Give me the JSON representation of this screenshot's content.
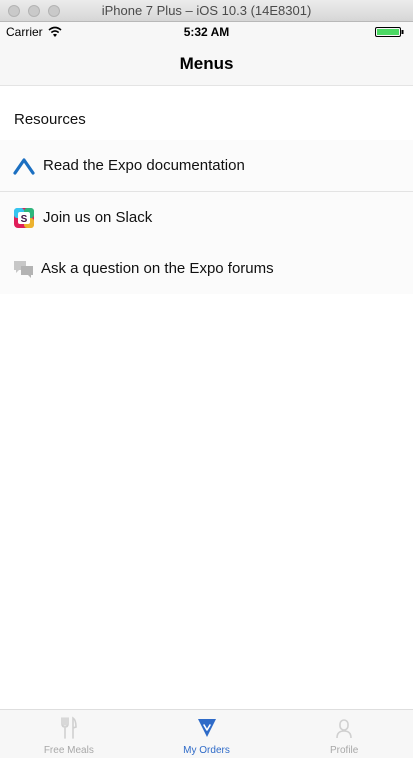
{
  "window": {
    "title": "iPhone 7 Plus – iOS 10.3 (14E8301)"
  },
  "status_bar": {
    "carrier": "Carrier",
    "time": "5:32 AM",
    "battery_color": "#4cd964"
  },
  "nav": {
    "title": "Menus"
  },
  "resources": {
    "header": "Resources",
    "items": [
      {
        "label": "Read the Expo documentation",
        "icon": "expo-icon"
      },
      {
        "label": "Join us on Slack",
        "icon": "slack-icon"
      },
      {
        "label": "Ask a question on the Expo forums",
        "icon": "forums-icon"
      }
    ]
  },
  "tabbar": {
    "tabs": [
      {
        "label": "Free Meals",
        "icon": "utensils-icon",
        "active": false
      },
      {
        "label": "My Orders",
        "icon": "orders-icon",
        "active": true
      },
      {
        "label": "Profile",
        "icon": "profile-icon",
        "active": false
      }
    ],
    "active_color": "#2f6bc8",
    "inactive_color": "#a8a8a8"
  }
}
